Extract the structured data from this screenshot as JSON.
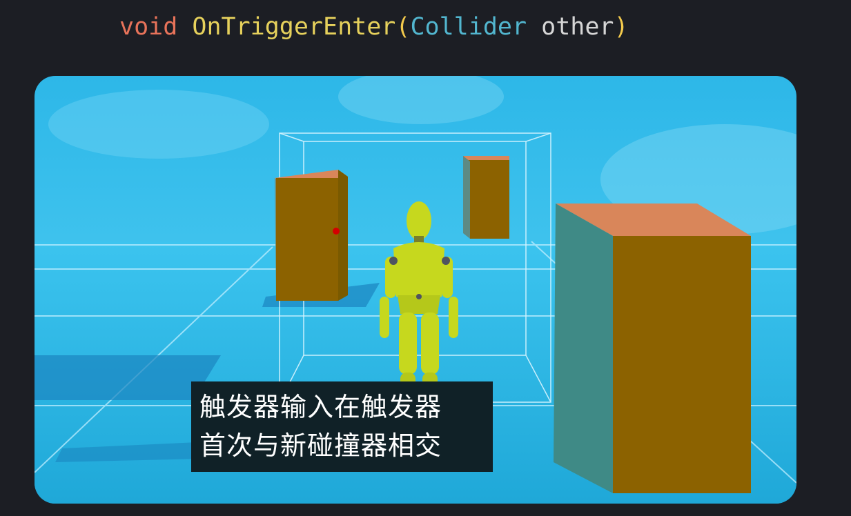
{
  "code": {
    "keyword": "void",
    "function_name": "OnTriggerEnter",
    "open_paren": "(",
    "param_type": "Collider",
    "param_name": "other",
    "close_paren": ")"
  },
  "subtitle": {
    "line1": "触发器输入在触发器",
    "line2": "首次与新碰撞器相交"
  },
  "colors": {
    "background": "#1c1e24",
    "keyword": "#e8735a",
    "function": "#e6d15c",
    "type": "#52b6cf",
    "sky": "#41c4ee",
    "box_front": "#8c6200",
    "box_top": "#d9865a",
    "character": "#c6d81e"
  },
  "icons": [
    "trigger-volume-wireframe",
    "character-mannequin",
    "contact-point-marker"
  ]
}
